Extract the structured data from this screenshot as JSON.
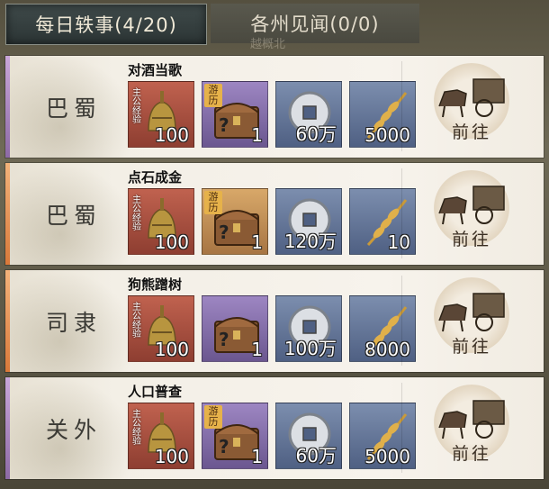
{
  "tabs": [
    {
      "label": "每日轶事(4/20)",
      "active": true
    },
    {
      "label": "各州见闻(0/0)",
      "active": false
    }
  ],
  "background_text": "越概北",
  "tasks": [
    {
      "region": "巴蜀",
      "title": "对酒当歌",
      "accent": "purple",
      "rewards": [
        {
          "type": "exp",
          "tag": "主公经验",
          "count": "100"
        },
        {
          "type": "chest",
          "tag": "游历",
          "count": "1"
        },
        {
          "type": "coin",
          "count": "60万"
        },
        {
          "type": "grain",
          "count": "5000"
        }
      ],
      "go_label": "前往"
    },
    {
      "region": "巴蜀",
      "title": "点石成金",
      "accent": "orange",
      "rewards": [
        {
          "type": "exp",
          "tag": "主公经验",
          "count": "100"
        },
        {
          "type": "chest",
          "tag": "游历",
          "count": "1"
        },
        {
          "type": "coin",
          "count": "120万"
        },
        {
          "type": "grain",
          "count": "10"
        }
      ],
      "go_label": "前往"
    },
    {
      "region": "司隶",
      "title": "狗熊蹭树",
      "accent": "orange",
      "rewards": [
        {
          "type": "exp",
          "tag": "主公经验",
          "count": "100"
        },
        {
          "type": "chest",
          "tag": "",
          "count": "1"
        },
        {
          "type": "coin",
          "count": "100万"
        },
        {
          "type": "grain",
          "count": "8000"
        }
      ],
      "go_label": "前往"
    },
    {
      "region": "关外",
      "title": "人口普查",
      "accent": "purple",
      "rewards": [
        {
          "type": "exp",
          "tag": "主公经验",
          "count": "100"
        },
        {
          "type": "chest",
          "tag": "游历",
          "count": "1"
        },
        {
          "type": "coin",
          "count": "60万"
        },
        {
          "type": "grain",
          "count": "5000"
        }
      ],
      "go_label": "前往"
    }
  ]
}
